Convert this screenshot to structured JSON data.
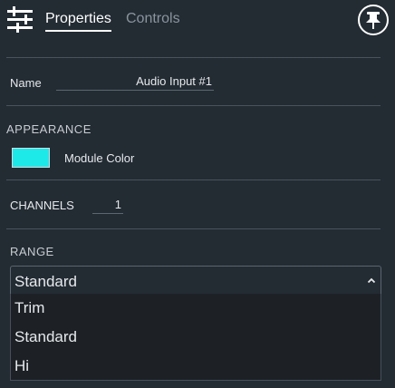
{
  "header": {
    "tabs": [
      {
        "label": "Properties",
        "active": true
      },
      {
        "label": "Controls",
        "active": false
      }
    ],
    "sliders_icon": "sliders-icon",
    "pin_icon": "pushpin-icon"
  },
  "properties": {
    "name_label": "Name",
    "name_value": "Audio Input #1",
    "appearance_title": "APPEARANCE",
    "module_color_label": "Module Color",
    "module_color": "#1de9e9",
    "channels_label": "CHANNELS",
    "channels_value": "1",
    "range_title": "RANGE",
    "range_selected": "Standard",
    "range_options": [
      "Trim",
      "Standard",
      "Hi"
    ]
  },
  "colors": {
    "background": "#232b33",
    "dropdown_background": "#1d2126",
    "divider": "#4a535c",
    "active_tab": "#ffffff",
    "inactive_tab": "#8a949e"
  }
}
